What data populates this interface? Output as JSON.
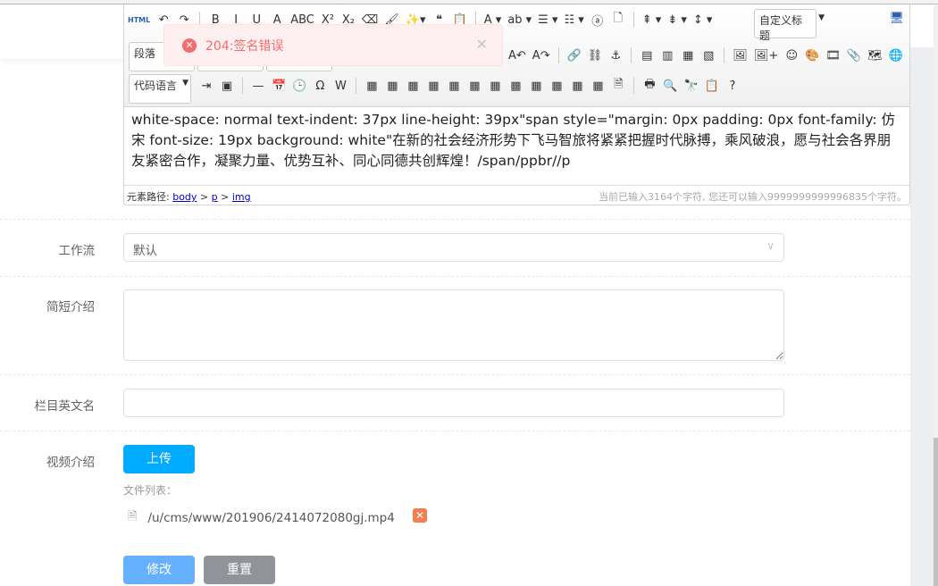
{
  "toolbar": {
    "row1": [
      "HTML",
      "↶",
      "↷",
      "|",
      "B",
      "I",
      "U",
      "A",
      "ABC",
      "X²",
      "X₂",
      "⌫",
      "🖌",
      "✨▾",
      "❝",
      "📋",
      "|",
      "A ▾",
      "ab ▾",
      "☰ ▾",
      "☷ ▾",
      "ⓐ",
      "🗋",
      "|",
      "⇞ ▾",
      "⇟ ▾",
      "↕ ▾"
    ],
    "custom_heading": "自定义标题",
    "fullscreen_icon": "🖥",
    "row2": [
      "A↶",
      "A↷",
      "|",
      "🔗",
      "⛓",
      "⚓",
      "|",
      "▤",
      "▥",
      "▦",
      "▧",
      "|",
      "🖼",
      "🖼+",
      "☺",
      "🎨",
      "🎞",
      "📎",
      "🗺",
      "🌐"
    ],
    "paragraph": "段落",
    "code_language": "代码语言",
    "row3": [
      "⇥",
      "▣",
      "|",
      "—",
      "📅",
      "🕒",
      "Ω",
      "W",
      "|",
      "▦",
      "▦",
      "▦",
      "▦",
      "▦",
      "▦",
      "▦",
      "▦",
      "▦",
      "▦",
      "▦",
      "▦",
      "🗎",
      "|",
      "🖶",
      "🔍",
      "🔭",
      "📋",
      "?"
    ]
  },
  "editor": {
    "content": "white-space: normal text-indent: 37px line-height: 39px\"span style=\"margin: 0px padding: 0px font-family: 仿宋 font-size: 19px background: white\"在新的社会经济形势下飞马智旅将紧紧把握时代脉搏，乘风破浪，愿与社会各界朋友紧密合作，凝聚力量、优势互补、同心同德共创辉煌！/span/ppbr//p",
    "path_label": "元素路径:",
    "path": [
      "body",
      "p",
      "img"
    ],
    "path_sep": ">",
    "count": "当前已输入3164个字符, 您还可以输入9999999999996835个字符。"
  },
  "toast": {
    "message": "204:签名错误",
    "icon": "error-icon",
    "close": "✕",
    "color": "#f56c6c"
  },
  "form": {
    "workflow": {
      "label": "工作流",
      "value": "默认"
    },
    "summary": {
      "label": "简短介绍",
      "value": ""
    },
    "english_name": {
      "label": "栏目英文名",
      "value": ""
    },
    "video": {
      "label": "视频介绍",
      "upload": "上传",
      "file_list_label": "文件列表：",
      "files": [
        "/u/cms/www/201906/2414072080gj.mp4"
      ]
    },
    "submit": "修改",
    "reset": "重置"
  },
  "colors": {
    "primary": "#00aaff",
    "submit": "#66b1ff",
    "reset": "#909399",
    "delete": "#f47e4e"
  }
}
